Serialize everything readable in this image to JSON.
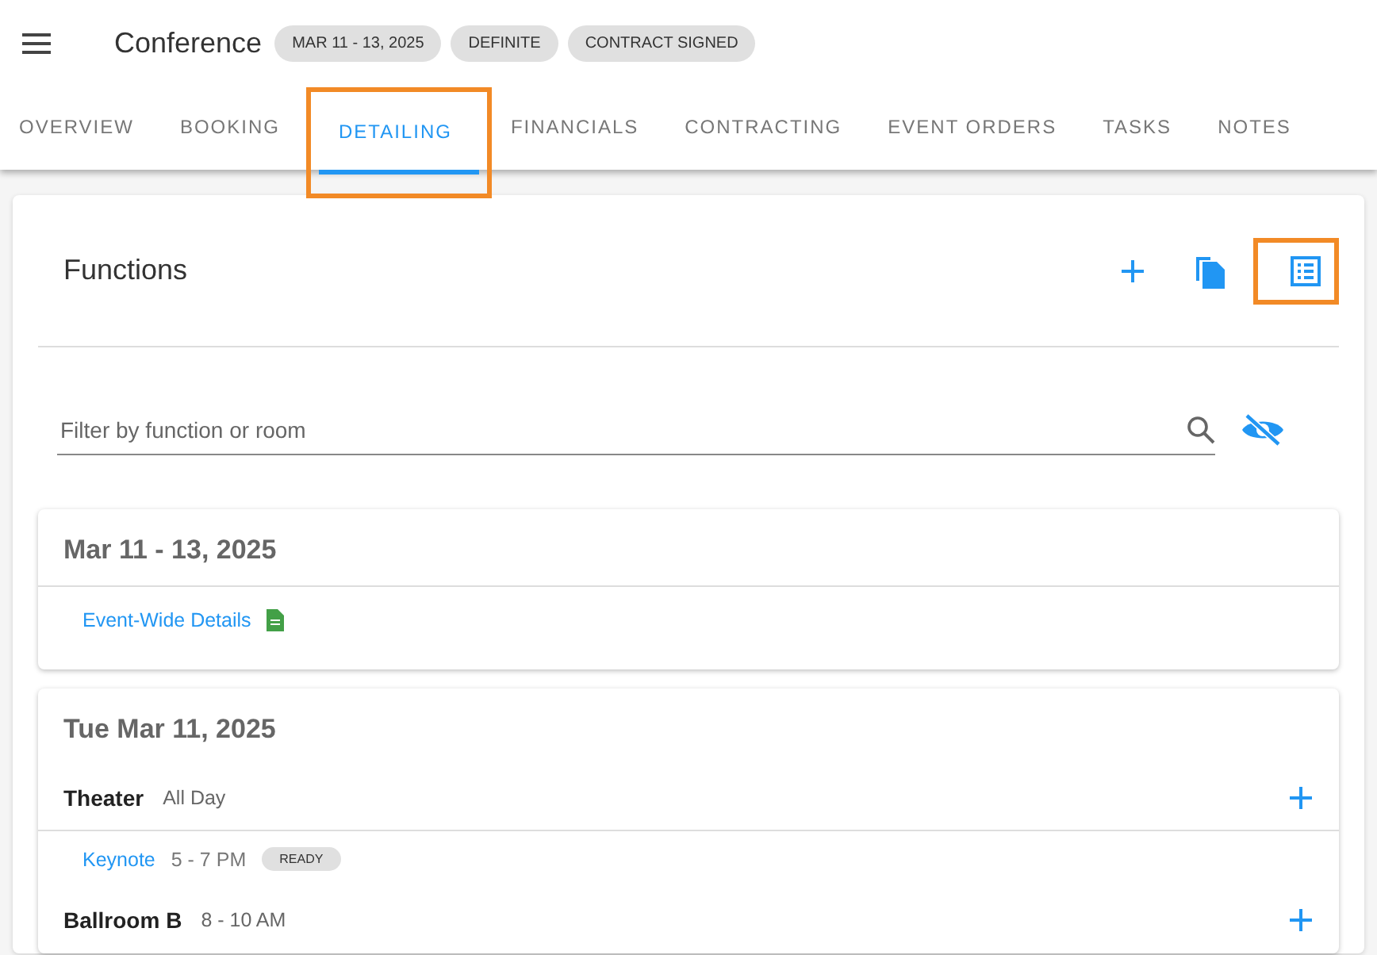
{
  "header": {
    "title": "Conference",
    "chips": [
      "MAR 11 - 13, 2025",
      "DEFINITE",
      "CONTRACT SIGNED"
    ]
  },
  "tabs": [
    {
      "label": "OVERVIEW",
      "selected": false,
      "highlighted": false
    },
    {
      "label": "BOOKING",
      "selected": false,
      "highlighted": false
    },
    {
      "label": "DETAILING",
      "selected": true,
      "highlighted": true
    },
    {
      "label": "FINANCIALS",
      "selected": false,
      "highlighted": false
    },
    {
      "label": "CONTRACTING",
      "selected": false,
      "highlighted": false
    },
    {
      "label": "EVENT ORDERS",
      "selected": false,
      "highlighted": false
    },
    {
      "label": "TASKS",
      "selected": false,
      "highlighted": false
    },
    {
      "label": "NOTES",
      "selected": false,
      "highlighted": false
    }
  ],
  "panel": {
    "title": "Functions",
    "actions": [
      {
        "kind": "add",
        "highlighted": false
      },
      {
        "kind": "copy",
        "highlighted": false
      },
      {
        "kind": "list",
        "highlighted": true
      }
    ],
    "filter": {
      "placeholder": "Filter by function or room"
    }
  },
  "sections": [
    {
      "title": "Mar 11 - 13, 2025",
      "rooms": [
        {
          "functions": [
            {
              "name": "Event-Wide Details",
              "kind": "doc"
            }
          ]
        }
      ]
    },
    {
      "title": "Tue Mar 11, 2025",
      "rooms": [
        {
          "name": "Theater",
          "time": "All Day",
          "functions": [
            {
              "name": "Keynote",
              "time": "5 - 7 PM",
              "status": "READY",
              "kind": "event"
            }
          ]
        },
        {
          "name": "Ballroom B",
          "time": "8 - 10 AM"
        }
      ]
    }
  ]
}
